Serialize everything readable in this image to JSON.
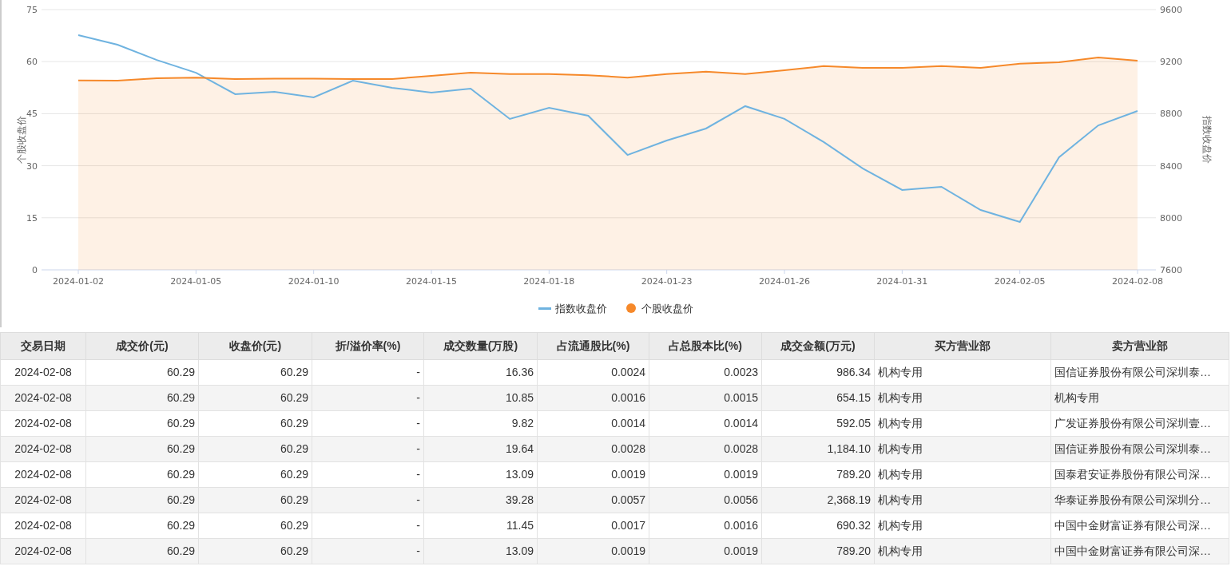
{
  "chart": {
    "chart_data": {
      "type": "line",
      "grid": true,
      "legend": "bottom",
      "ylabel": "个股收盘价",
      "y2label": "指数收盘价",
      "ylim": [
        0,
        75
      ],
      "yticks": [
        0,
        15,
        30,
        45,
        60,
        75
      ],
      "y2lim": [
        7600,
        9600
      ],
      "y2ticks": [
        7600,
        8000,
        8400,
        8800,
        9200,
        9600
      ],
      "categories": [
        "2024-01-02",
        null,
        null,
        "2024-01-05",
        null,
        null,
        "2024-01-10",
        null,
        null,
        "2024-01-15",
        null,
        null,
        "2024-01-18",
        null,
        null,
        "2024-01-23",
        null,
        null,
        "2024-01-26",
        null,
        null,
        "2024-01-31",
        null,
        null,
        "2024-02-05",
        null,
        null,
        "2024-02-08"
      ],
      "series": [
        {
          "name": "指数收盘价",
          "type": "line",
          "color": "#6fb3e0",
          "axis": "y2",
          "values": [
            9404,
            9330,
            9213,
            9115,
            8950,
            8968,
            8925,
            9054,
            8999,
            8962,
            8993,
            8760,
            8845,
            8784,
            8483,
            8594,
            8686,
            8858,
            8760,
            8582,
            8379,
            8214,
            8238,
            8060,
            7968,
            8465,
            8710,
            8821
          ]
        },
        {
          "name": "个股收盘价",
          "type": "area",
          "color": "#f6892a",
          "values": [
            54.6,
            54.5,
            55.2,
            55.4,
            55.0,
            55.1,
            55.1,
            55.0,
            55.0,
            55.9,
            56.8,
            56.4,
            56.4,
            56.1,
            55.4,
            56.4,
            57.1,
            56.4,
            57.5,
            58.7,
            58.2,
            58.2,
            58.7,
            58.2,
            59.4,
            59.8,
            61.2,
            60.3
          ]
        }
      ]
    }
  },
  "table": {
    "columns": [
      "交易日期",
      "成交价(元)",
      "收盘价(元)",
      "折/溢价率(%)",
      "成交数量(万股)",
      "占流通股比(%)",
      "占总股本比(%)",
      "成交金额(万元)",
      "买方营业部",
      "卖方营业部"
    ],
    "rows": [
      [
        "2024-02-08",
        "60.29",
        "60.29",
        "-",
        "16.36",
        "0.0024",
        "0.0023",
        "986.34",
        "机构专用",
        "国信证券股份有限公司深圳泰…"
      ],
      [
        "2024-02-08",
        "60.29",
        "60.29",
        "-",
        "10.85",
        "0.0016",
        "0.0015",
        "654.15",
        "机构专用",
        "机构专用"
      ],
      [
        "2024-02-08",
        "60.29",
        "60.29",
        "-",
        "9.82",
        "0.0014",
        "0.0014",
        "592.05",
        "机构专用",
        "广发证券股份有限公司深圳壹…"
      ],
      [
        "2024-02-08",
        "60.29",
        "60.29",
        "-",
        "19.64",
        "0.0028",
        "0.0028",
        "1,184.10",
        "机构专用",
        "国信证券股份有限公司深圳泰…"
      ],
      [
        "2024-02-08",
        "60.29",
        "60.29",
        "-",
        "13.09",
        "0.0019",
        "0.0019",
        "789.20",
        "机构专用",
        "国泰君安证券股份有限公司深…"
      ],
      [
        "2024-02-08",
        "60.29",
        "60.29",
        "-",
        "39.28",
        "0.0057",
        "0.0056",
        "2,368.19",
        "机构专用",
        "华泰证券股份有限公司深圳分…"
      ],
      [
        "2024-02-08",
        "60.29",
        "60.29",
        "-",
        "11.45",
        "0.0017",
        "0.0016",
        "690.32",
        "机构专用",
        "中国中金财富证券有限公司深…"
      ],
      [
        "2024-02-08",
        "60.29",
        "60.29",
        "-",
        "13.09",
        "0.0019",
        "0.0019",
        "789.20",
        "机构专用",
        "中国中金财富证券有限公司深…"
      ]
    ]
  }
}
